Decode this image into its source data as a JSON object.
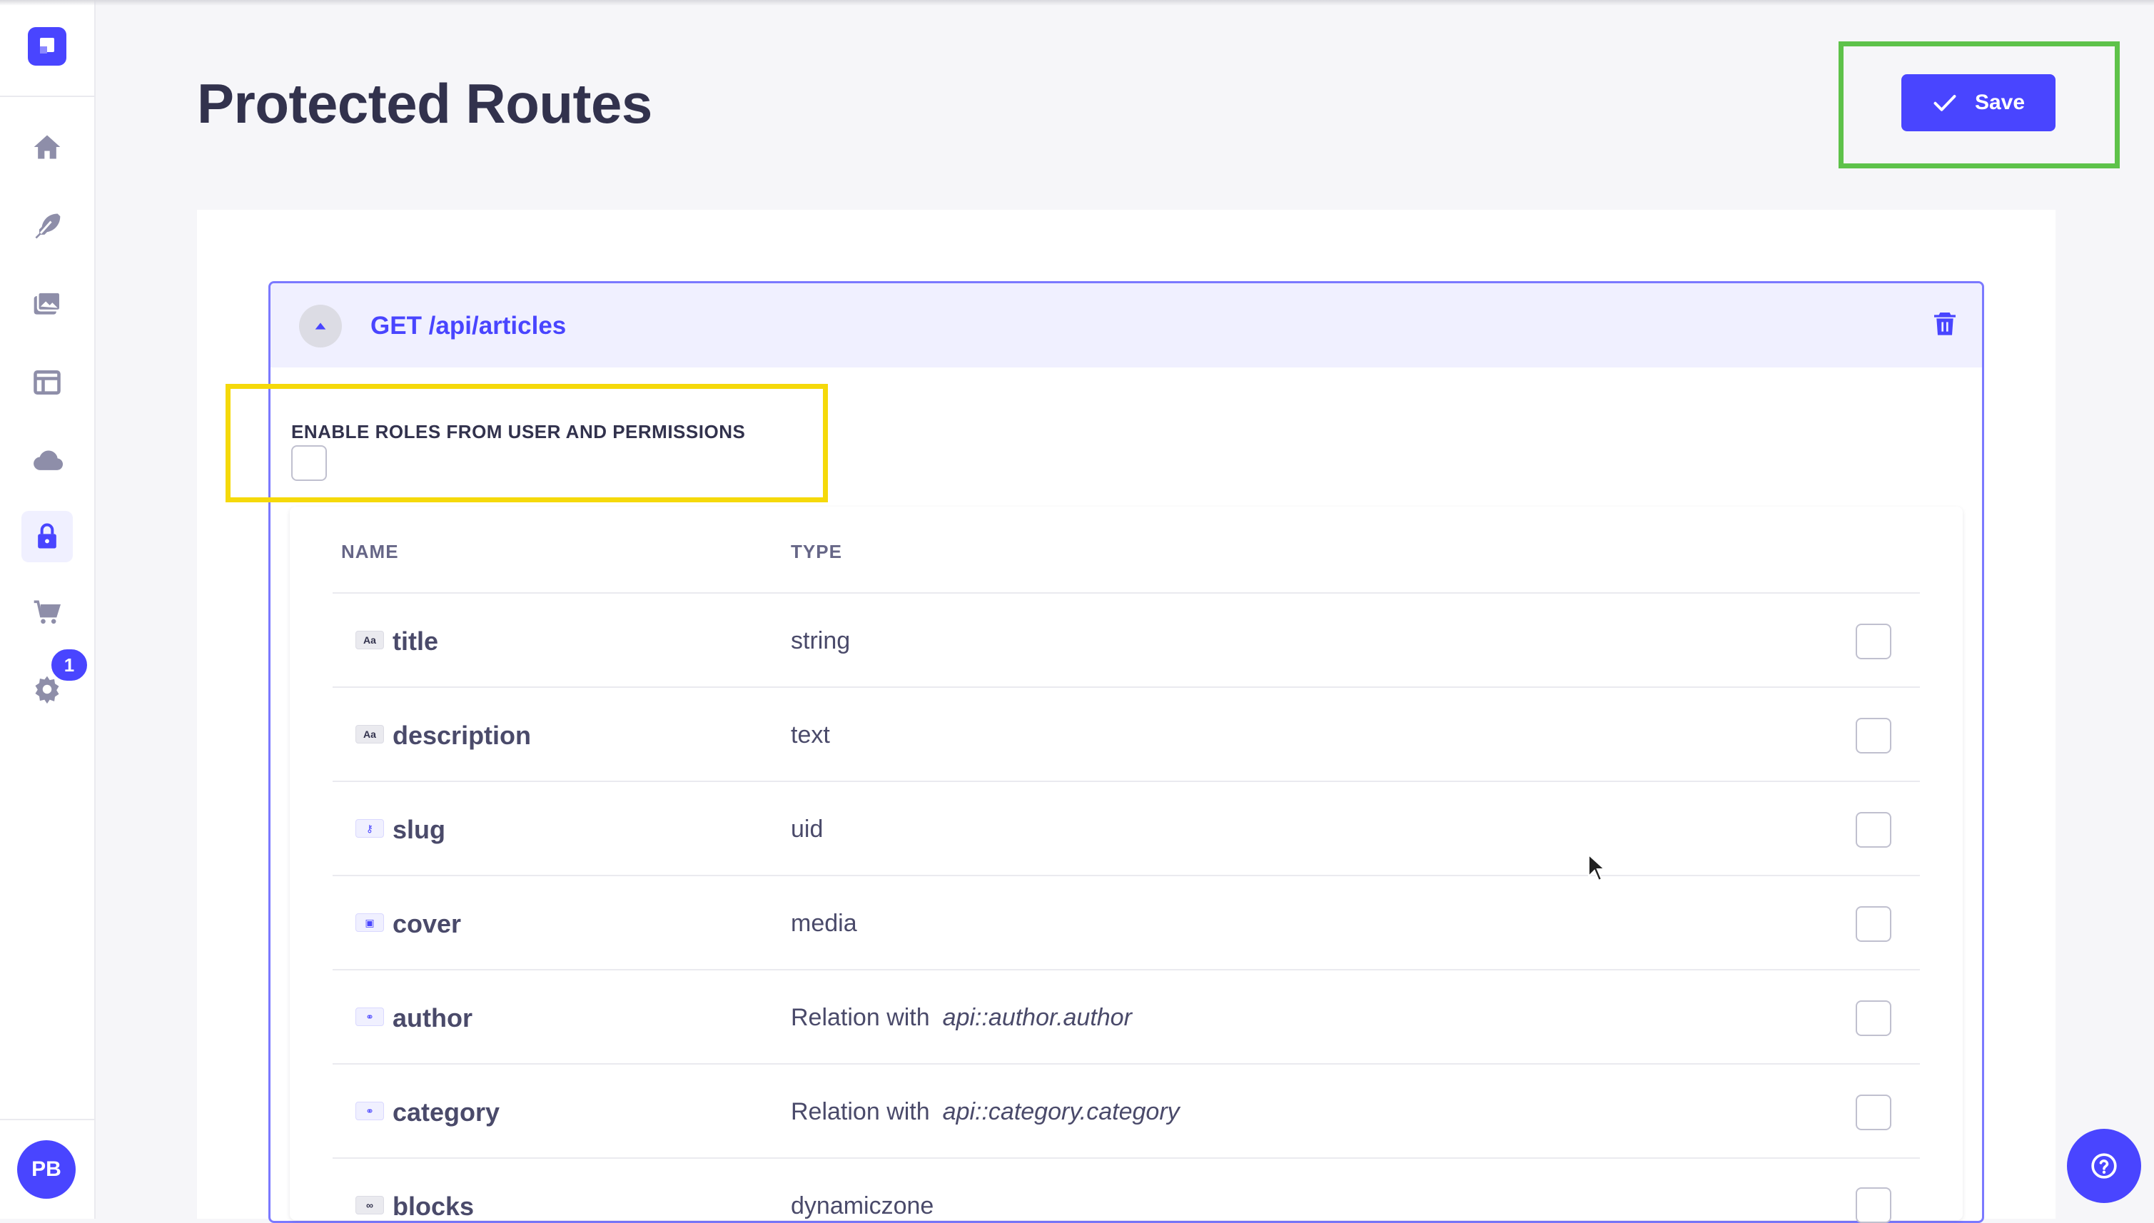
{
  "page": {
    "title": "Protected Routes"
  },
  "actions": {
    "save_label": "Save"
  },
  "sidebar": {
    "items": [
      {
        "icon": "home-icon"
      },
      {
        "icon": "feather-icon"
      },
      {
        "icon": "media-library-icon"
      },
      {
        "icon": "layout-icon"
      },
      {
        "icon": "cloud-icon"
      },
      {
        "icon": "lock-icon",
        "active": true
      },
      {
        "icon": "cart-icon"
      },
      {
        "icon": "gear-icon",
        "badge": "1"
      }
    ],
    "user_initials": "PB"
  },
  "route": {
    "title": "GET /api/articles",
    "roles_label": "ENABLE ROLES FROM USER AND PERMISSIONS",
    "roles_enabled": false,
    "columns": {
      "name": "NAME",
      "type": "TYPE"
    },
    "fields": [
      {
        "name": "title",
        "type": "string",
        "icon": "text-icon",
        "icon_glyph": "Aa"
      },
      {
        "name": "description",
        "type": "text",
        "icon": "text-icon",
        "icon_glyph": "Aa"
      },
      {
        "name": "slug",
        "type": "uid",
        "icon": "key-icon",
        "icon_glyph": "⚷"
      },
      {
        "name": "cover",
        "type": "media",
        "icon": "image-icon",
        "icon_glyph": "▣"
      },
      {
        "name": "author",
        "type": "Relation with",
        "target": "api::author.author",
        "icon": "relation-icon",
        "icon_glyph": "⚭"
      },
      {
        "name": "category",
        "type": "Relation with",
        "target": "api::category.category",
        "icon": "relation-icon",
        "icon_glyph": "⚭"
      },
      {
        "name": "blocks",
        "type": "dynamiczone",
        "icon": "dynamic-zone-icon",
        "icon_glyph": "∞"
      }
    ]
  },
  "colors": {
    "primary": "#4945ff",
    "highlight_save": "#5ec24a",
    "highlight_roles": "#f5d90a",
    "panel_header": "#f0f0ff"
  }
}
